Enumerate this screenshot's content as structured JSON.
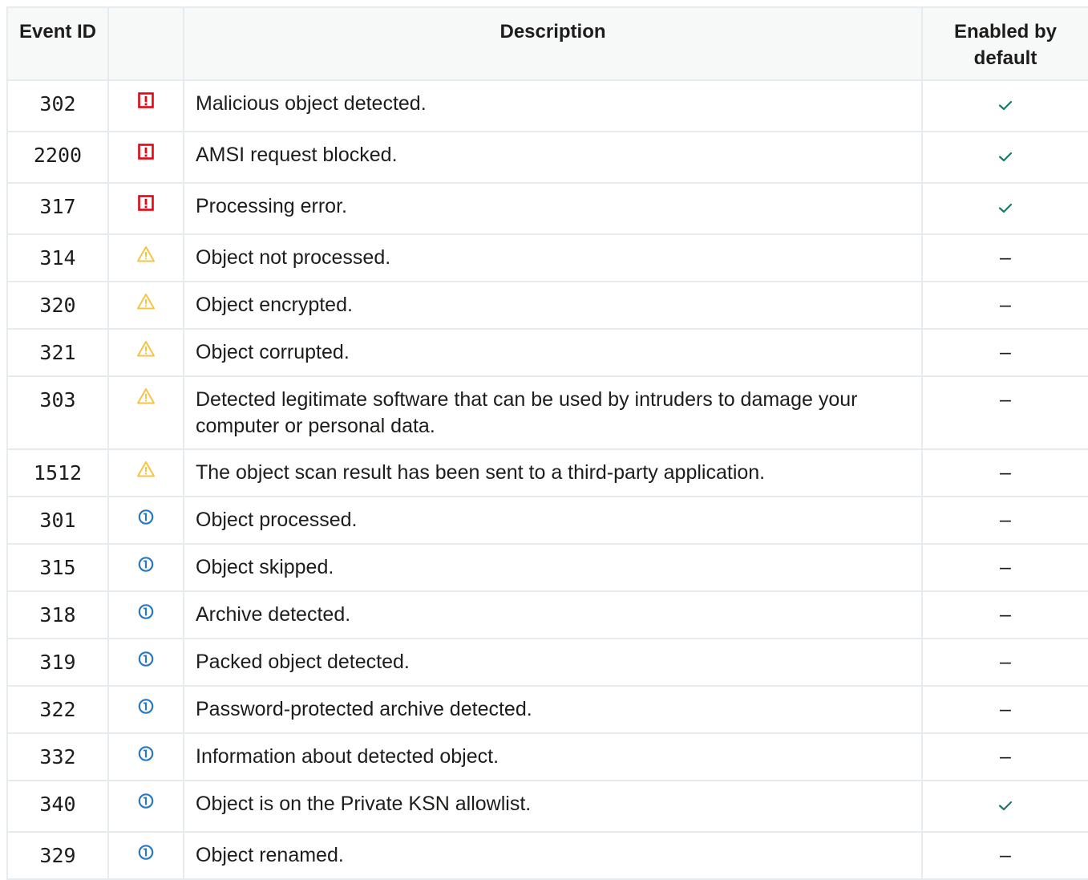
{
  "headers": {
    "event_id": "Event ID",
    "icon": "",
    "description": "Description",
    "enabled": "Enabled by default"
  },
  "colors": {
    "critical": "#e30613",
    "warning": "#f6c445",
    "info": "#2a78c2",
    "check": "#1a7a6a",
    "border": "#e6ebef",
    "header_bg": "#f7f8f8"
  },
  "rows": [
    {
      "id": "302",
      "level": "critical-icon",
      "description": "Malicious object detected.",
      "enabled": "check"
    },
    {
      "id": "2200",
      "level": "critical-icon",
      "description": "AMSI request blocked.",
      "enabled": "check"
    },
    {
      "id": "317",
      "level": "critical-icon",
      "description": "Processing error.",
      "enabled": "check"
    },
    {
      "id": "314",
      "level": "warning-icon",
      "description": "Object not processed.",
      "enabled": "–"
    },
    {
      "id": "320",
      "level": "warning-icon",
      "description": "Object encrypted.",
      "enabled": "–"
    },
    {
      "id": "321",
      "level": "warning-icon",
      "description": "Object corrupted.",
      "enabled": "–"
    },
    {
      "id": "303",
      "level": "warning-icon",
      "description": "Detected legitimate software that can be used by intruders to damage your computer or personal data.",
      "enabled": "–"
    },
    {
      "id": "1512",
      "level": "warning-icon",
      "description": "The object scan result has been sent to a third-party application.",
      "enabled": "–"
    },
    {
      "id": "301",
      "level": "info-icon",
      "description": "Object processed.",
      "enabled": "–"
    },
    {
      "id": "315",
      "level": "info-icon",
      "description": "Object skipped.",
      "enabled": "–"
    },
    {
      "id": "318",
      "level": "info-icon",
      "description": "Archive detected.",
      "enabled": "–"
    },
    {
      "id": "319",
      "level": "info-icon",
      "description": "Packed object detected.",
      "enabled": "–"
    },
    {
      "id": "322",
      "level": "info-icon",
      "description": "Password-protected archive detected.",
      "enabled": "–"
    },
    {
      "id": "332",
      "level": "info-icon",
      "description": "Information about detected object.",
      "enabled": "–"
    },
    {
      "id": "340",
      "level": "info-icon",
      "description": "Object is on the Private KSN allowlist.",
      "enabled": "check"
    },
    {
      "id": "329",
      "level": "info-icon",
      "description": "Object renamed.",
      "enabled": "–"
    }
  ]
}
